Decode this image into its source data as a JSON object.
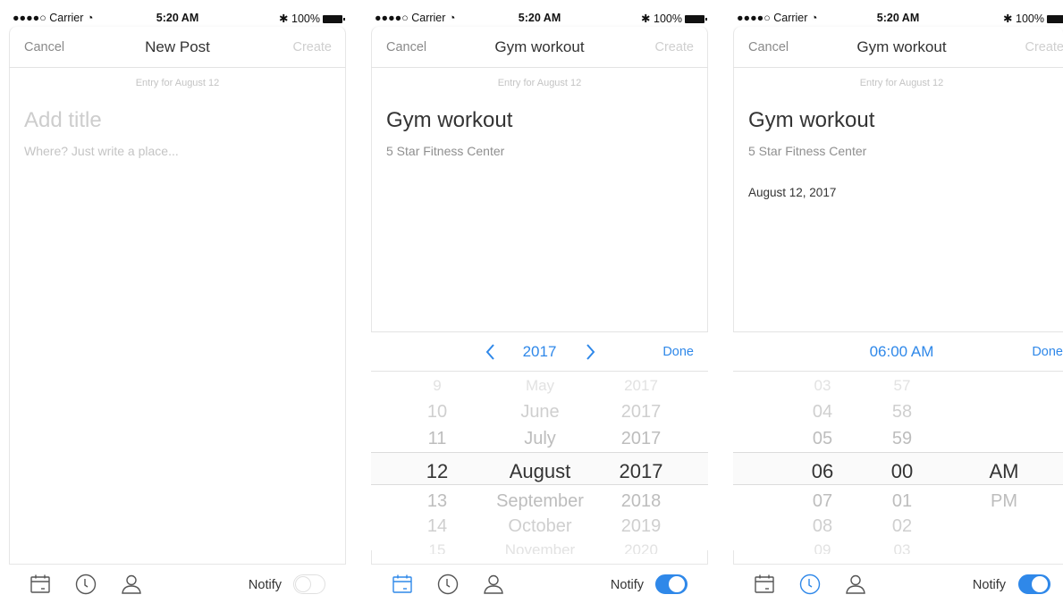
{
  "status_bar": {
    "carrier": "●●●●○ Carrier",
    "time": "5:20 AM",
    "battery": "100%"
  },
  "screens": [
    {
      "nav": {
        "cancel": "Cancel",
        "title": "New Post",
        "create": "Create"
      },
      "entry": "Entry for August 12",
      "title_placeholder": "Add title",
      "place_placeholder": "Where? Just write a place...",
      "toolbar": {
        "notify": "Notify",
        "notify_on": false,
        "active_icon": "none"
      }
    },
    {
      "nav": {
        "cancel": "Cancel",
        "title": "Gym workout",
        "create": "Create"
      },
      "entry": "Entry for August 12",
      "title": "Gym workout",
      "place": "5 Star Fitness Center",
      "picker_bar": {
        "year": "2017",
        "done": "Done",
        "prev_icon": "chevron-left-icon",
        "next_icon": "chevron-right-icon"
      },
      "date_wheel": {
        "days": [
          "9",
          "10",
          "11",
          "12",
          "13",
          "14",
          "15"
        ],
        "months": [
          "May",
          "June",
          "July",
          "August",
          "September",
          "October",
          "November"
        ],
        "years": [
          "2017",
          "2017",
          "2017",
          "2017",
          "2018",
          "2019",
          "2020"
        ],
        "selected_index": 3
      },
      "toolbar": {
        "notify": "Notify",
        "notify_on": true,
        "active_icon": "calendar-icon"
      }
    },
    {
      "nav": {
        "cancel": "Cancel",
        "title": "Gym workout",
        "create": "Create"
      },
      "entry": "Entry for August 12",
      "title": "Gym workout",
      "place": "5 Star Fitness Center",
      "date": "August 12, 2017",
      "picker_bar": {
        "time": "06:00 AM",
        "done": "Done"
      },
      "time_wheel": {
        "hours": [
          "03",
          "04",
          "05",
          "06",
          "07",
          "08",
          "09"
        ],
        "minutes": [
          "57",
          "58",
          "59",
          "00",
          "01",
          "02",
          "03"
        ],
        "periods": [
          "",
          "",
          "",
          "AM",
          "PM",
          "",
          ""
        ],
        "selected_index": 3
      },
      "toolbar": {
        "notify": "Notify",
        "notify_on": true,
        "active_icon": "clock-icon"
      }
    }
  ],
  "colors": {
    "accent": "#2f88e9",
    "placeholder": "#c4c4c4",
    "muted": "#8f8f8f"
  }
}
